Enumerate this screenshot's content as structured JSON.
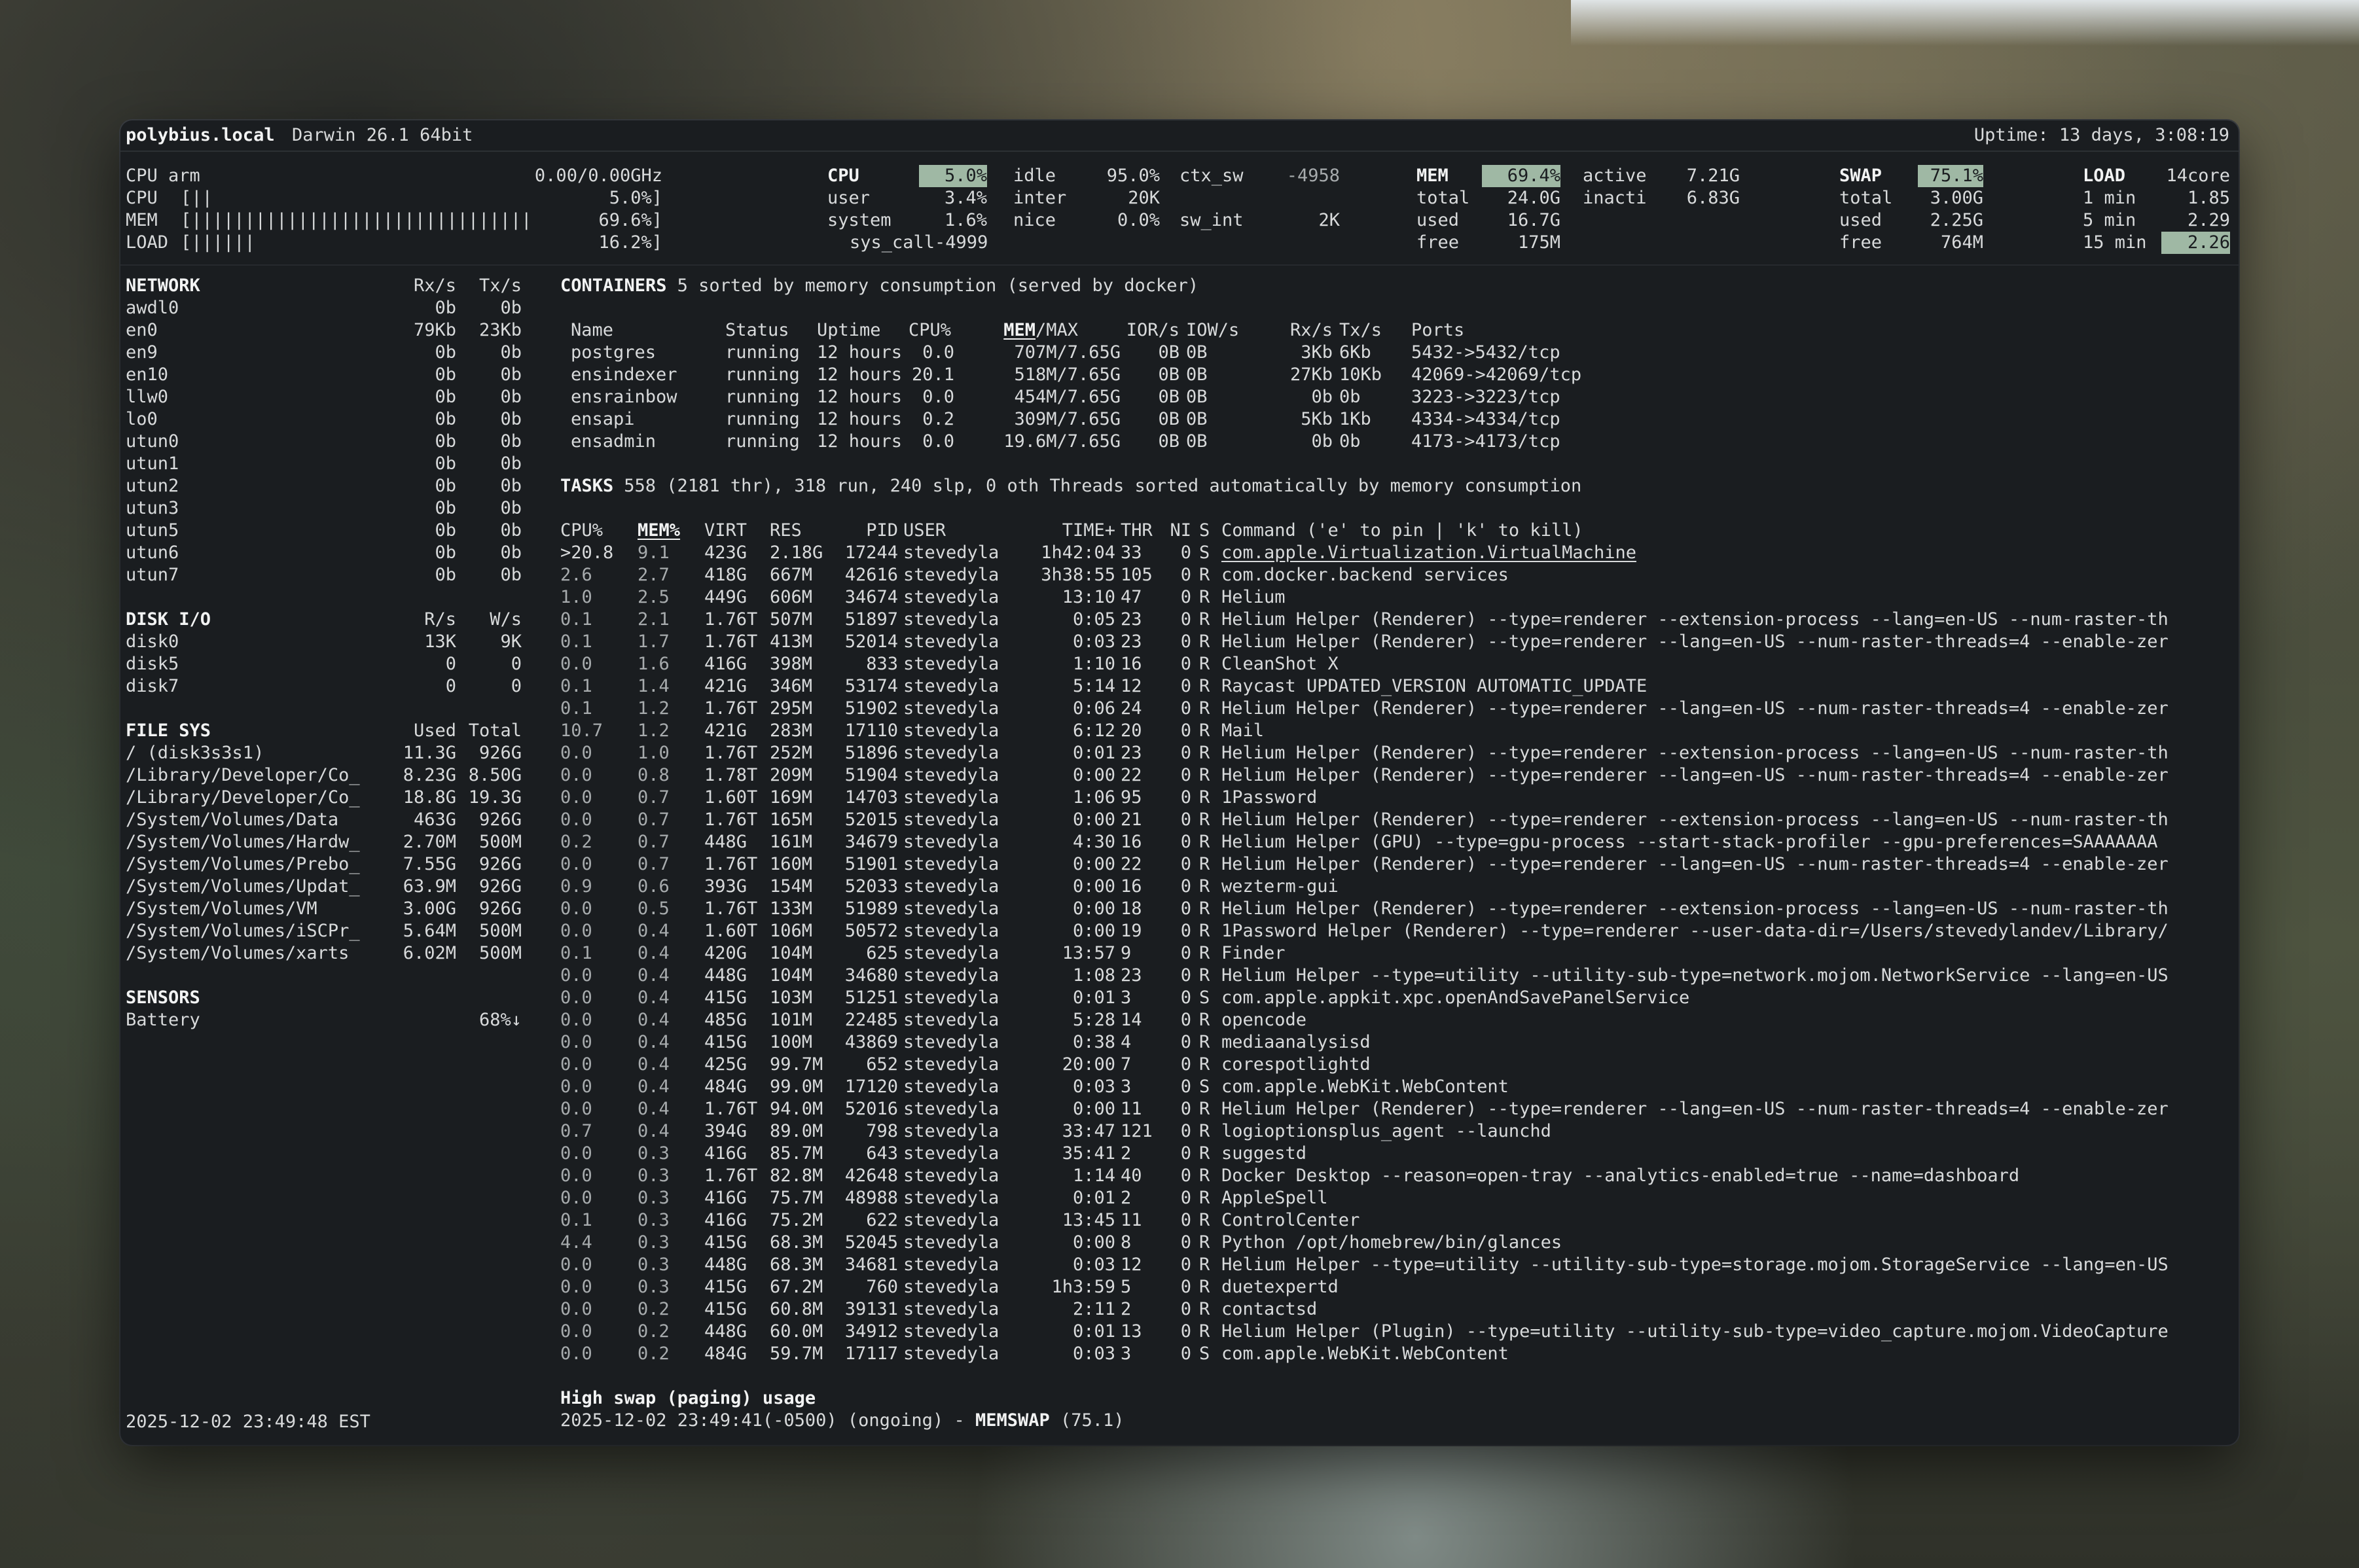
{
  "title": {
    "host": "polybius.local",
    "os": "Darwin 26.1 64bit",
    "uptime": "Uptime: 13 days, 3:08:19"
  },
  "quicklook": {
    "cpu_name": "CPU arm",
    "cpu_freq": "0.00/0.00GHz",
    "bars": [
      {
        "label": "CPU",
        "bar": "[||",
        "value": "5.0%]"
      },
      {
        "label": "MEM",
        "bar": "[||||||||||||||||||||||||||||||||",
        "value": "69.6%]"
      },
      {
        "label": "LOAD",
        "bar": "[||||||",
        "value": "16.2%]"
      }
    ]
  },
  "cpu": {
    "title": "CPU",
    "total": "5.0%",
    "rows": [
      [
        "idle",
        "95.0%",
        "ctx_sw",
        "-4958"
      ],
      [
        "user",
        "3.4%",
        "inter",
        "20K"
      ],
      [
        "system",
        "1.6%",
        "nice",
        "0.0%",
        "sw_int",
        "2K"
      ]
    ],
    "syscall": "sys_call-4999"
  },
  "mem": {
    "title": "MEM",
    "total_pct": "69.4%",
    "rows": [
      [
        "total",
        "24.0G",
        "active",
        "7.21G"
      ],
      [
        "used",
        "16.7G",
        "inacti",
        "6.83G"
      ],
      [
        "free",
        "175M"
      ]
    ]
  },
  "swap": {
    "title": "SWAP",
    "pct": "75.1%",
    "rows": [
      [
        "total",
        "3.00G"
      ],
      [
        "used",
        "2.25G"
      ],
      [
        "free",
        "764M"
      ]
    ]
  },
  "load": {
    "title": "LOAD",
    "cores": "14core",
    "rows": [
      [
        "1 min",
        "1.85"
      ],
      [
        "5 min",
        "2.29"
      ],
      [
        "15 min",
        "2.26"
      ]
    ]
  },
  "network": {
    "title": "NETWORK",
    "rx": "Rx/s",
    "tx": "Tx/s",
    "rows": [
      [
        "awdl0",
        "0b",
        "0b"
      ],
      [
        "en0",
        "79Kb",
        "23Kb"
      ],
      [
        "en9",
        "0b",
        "0b"
      ],
      [
        "en10",
        "0b",
        "0b"
      ],
      [
        "llw0",
        "0b",
        "0b"
      ],
      [
        "lo0",
        "0b",
        "0b"
      ],
      [
        "utun0",
        "0b",
        "0b"
      ],
      [
        "utun1",
        "0b",
        "0b"
      ],
      [
        "utun2",
        "0b",
        "0b"
      ],
      [
        "utun3",
        "0b",
        "0b"
      ],
      [
        "utun5",
        "0b",
        "0b"
      ],
      [
        "utun6",
        "0b",
        "0b"
      ],
      [
        "utun7",
        "0b",
        "0b"
      ]
    ]
  },
  "diskio": {
    "title": "DISK I/O",
    "r": "R/s",
    "w": "W/s",
    "rows": [
      [
        "disk0",
        "13K",
        "9K"
      ],
      [
        "disk5",
        "0",
        "0"
      ],
      [
        "disk7",
        "0",
        "0"
      ]
    ]
  },
  "fs": {
    "title": "FILE SYS",
    "used": "Used",
    "total": "Total",
    "rows": [
      [
        "/ (disk3s3s1)",
        "11.3G",
        "926G"
      ],
      [
        "/Library/Developer/Co_",
        "8.23G",
        "8.50G"
      ],
      [
        "/Library/Developer/Co_",
        "18.8G",
        "19.3G"
      ],
      [
        "/System/Volumes/Data",
        "463G",
        "926G"
      ],
      [
        "/System/Volumes/Hardw_",
        "2.70M",
        "500M"
      ],
      [
        "/System/Volumes/Prebo_",
        "7.55G",
        "926G"
      ],
      [
        "/System/Volumes/Updat_",
        "63.9M",
        "926G"
      ],
      [
        "/System/Volumes/VM",
        "3.00G",
        "926G"
      ],
      [
        "/System/Volumes/iSCPr_",
        "5.64M",
        "500M"
      ],
      [
        "/System/Volumes/xarts",
        "6.02M",
        "500M"
      ]
    ]
  },
  "sensors": {
    "title": "SENSORS",
    "rows": [
      [
        "Battery",
        "68%↓"
      ]
    ]
  },
  "datetime": "2025-12-02 23:49:48 EST",
  "containers": {
    "title": "CONTAINERS",
    "subtitle": "5 sorted by memory consumption (served by docker)",
    "headers": [
      "Name",
      "Status",
      "Uptime",
      "CPU%",
      "MEM",
      "/MAX",
      "IOR/s",
      "IOW/s",
      "Rx/s",
      "Tx/s",
      "Ports"
    ],
    "rows": [
      [
        "postgres",
        "running",
        "12 hours",
        "0.0",
        "707M/7.65G",
        "0B",
        "0B",
        "3Kb",
        "6Kb",
        "5432->5432/tcp"
      ],
      [
        "ensindexer",
        "running",
        "12 hours",
        "20.1",
        "518M/7.65G",
        "0B",
        "0B",
        "27Kb",
        "10Kb",
        "42069->42069/tcp"
      ],
      [
        "ensrainbow",
        "running",
        "12 hours",
        "0.0",
        "454M/7.65G",
        "0B",
        "0B",
        "0b",
        "0b",
        "3223->3223/tcp"
      ],
      [
        "ensapi",
        "running",
        "12 hours",
        "0.2",
        "309M/7.65G",
        "0B",
        "0B",
        "5Kb",
        "1Kb",
        "4334->4334/tcp"
      ],
      [
        "ensadmin",
        "running",
        "12 hours",
        "0.0",
        "19.6M/7.65G",
        "0B",
        "0B",
        "0b",
        "0b",
        "4173->4173/tcp"
      ]
    ]
  },
  "tasks": {
    "title": "TASKS",
    "summary": "558 (2181 thr), 318 run, 240 slp, 0 oth Threads sorted automatically by memory consumption"
  },
  "processes": {
    "headers": [
      "CPU%",
      "MEM%",
      "VIRT",
      "RES",
      "PID",
      "USER",
      "TIME+",
      "THR",
      "NI",
      "S",
      "Command ('e' to pin | 'k' to kill)"
    ],
    "rows": [
      [
        ">20.8",
        "9.1",
        "423G",
        "2.18G",
        "17244",
        "stevedyla",
        "1h42:04",
        "33",
        "0",
        "S",
        "com.apple.Virtualization.VirtualMachine"
      ],
      [
        "2.6",
        "2.7",
        "418G",
        "667M",
        "42616",
        "stevedyla",
        "3h38:55",
        "105",
        "0",
        "R",
        "com.docker.backend services"
      ],
      [
        "1.0",
        "2.5",
        "449G",
        "606M",
        "34674",
        "stevedyla",
        "13:10",
        "47",
        "0",
        "R",
        "Helium"
      ],
      [
        "0.1",
        "2.1",
        "1.76T",
        "507M",
        "51897",
        "stevedyla",
        "0:05",
        "23",
        "0",
        "R",
        "Helium Helper (Renderer) --type=renderer --extension-process --lang=en-US --num-raster-th"
      ],
      [
        "0.1",
        "1.7",
        "1.76T",
        "413M",
        "52014",
        "stevedyla",
        "0:03",
        "23",
        "0",
        "R",
        "Helium Helper (Renderer) --type=renderer --lang=en-US --num-raster-threads=4 --enable-zer"
      ],
      [
        "0.0",
        "1.6",
        "416G",
        "398M",
        "833",
        "stevedyla",
        "1:10",
        "16",
        "0",
        "R",
        "CleanShot X"
      ],
      [
        "0.1",
        "1.4",
        "421G",
        "346M",
        "53174",
        "stevedyla",
        "5:14",
        "12",
        "0",
        "R",
        "Raycast UPDATED_VERSION AUTOMATIC_UPDATE"
      ],
      [
        "0.1",
        "1.2",
        "1.76T",
        "295M",
        "51902",
        "stevedyla",
        "0:06",
        "24",
        "0",
        "R",
        "Helium Helper (Renderer) --type=renderer --lang=en-US --num-raster-threads=4 --enable-zer"
      ],
      [
        "10.7",
        "1.2",
        "421G",
        "283M",
        "17110",
        "stevedyla",
        "6:12",
        "20",
        "0",
        "R",
        "Mail"
      ],
      [
        "0.0",
        "1.0",
        "1.76T",
        "252M",
        "51896",
        "stevedyla",
        "0:01",
        "23",
        "0",
        "R",
        "Helium Helper (Renderer) --type=renderer --extension-process --lang=en-US --num-raster-th"
      ],
      [
        "0.0",
        "0.8",
        "1.78T",
        "209M",
        "51904",
        "stevedyla",
        "0:00",
        "22",
        "0",
        "R",
        "Helium Helper (Renderer) --type=renderer --lang=en-US --num-raster-threads=4 --enable-zer"
      ],
      [
        "0.0",
        "0.7",
        "1.60T",
        "169M",
        "14703",
        "stevedyla",
        "1:06",
        "95",
        "0",
        "R",
        "1Password"
      ],
      [
        "0.0",
        "0.7",
        "1.76T",
        "165M",
        "52015",
        "stevedyla",
        "0:00",
        "21",
        "0",
        "R",
        "Helium Helper (Renderer) --type=renderer --extension-process --lang=en-US --num-raster-th"
      ],
      [
        "0.2",
        "0.7",
        "448G",
        "161M",
        "34679",
        "stevedyla",
        "4:30",
        "16",
        "0",
        "R",
        "Helium Helper (GPU) --type=gpu-process --start-stack-profiler --gpu-preferences=SAAAAAAA"
      ],
      [
        "0.0",
        "0.7",
        "1.76T",
        "160M",
        "51901",
        "stevedyla",
        "0:00",
        "22",
        "0",
        "R",
        "Helium Helper (Renderer) --type=renderer --lang=en-US --num-raster-threads=4 --enable-zer"
      ],
      [
        "0.9",
        "0.6",
        "393G",
        "154M",
        "52033",
        "stevedyla",
        "0:00",
        "16",
        "0",
        "R",
        "wezterm-gui"
      ],
      [
        "0.0",
        "0.5",
        "1.76T",
        "133M",
        "51989",
        "stevedyla",
        "0:00",
        "18",
        "0",
        "R",
        "Helium Helper (Renderer) --type=renderer --extension-process --lang=en-US --num-raster-th"
      ],
      [
        "0.0",
        "0.4",
        "1.60T",
        "106M",
        "50572",
        "stevedyla",
        "0:00",
        "19",
        "0",
        "R",
        "1Password Helper (Renderer) --type=renderer --user-data-dir=/Users/stevedylandev/Library/"
      ],
      [
        "0.1",
        "0.4",
        "420G",
        "104M",
        "625",
        "stevedyla",
        "13:57",
        "9",
        "0",
        "R",
        "Finder"
      ],
      [
        "0.0",
        "0.4",
        "448G",
        "104M",
        "34680",
        "stevedyla",
        "1:08",
        "23",
        "0",
        "R",
        "Helium Helper --type=utility --utility-sub-type=network.mojom.NetworkService --lang=en-US"
      ],
      [
        "0.0",
        "0.4",
        "415G",
        "103M",
        "51251",
        "stevedyla",
        "0:01",
        "3",
        "0",
        "S",
        "com.apple.appkit.xpc.openAndSavePanelService"
      ],
      [
        "0.0",
        "0.4",
        "485G",
        "101M",
        "22485",
        "stevedyla",
        "5:28",
        "14",
        "0",
        "R",
        "opencode"
      ],
      [
        "0.0",
        "0.4",
        "415G",
        "100M",
        "43869",
        "stevedyla",
        "0:38",
        "4",
        "0",
        "R",
        "mediaanalysisd"
      ],
      [
        "0.0",
        "0.4",
        "425G",
        "99.7M",
        "652",
        "stevedyla",
        "20:00",
        "7",
        "0",
        "R",
        "corespotlightd"
      ],
      [
        "0.0",
        "0.4",
        "484G",
        "99.0M",
        "17120",
        "stevedyla",
        "0:03",
        "3",
        "0",
        "S",
        "com.apple.WebKit.WebContent"
      ],
      [
        "0.0",
        "0.4",
        "1.76T",
        "94.0M",
        "52016",
        "stevedyla",
        "0:00",
        "11",
        "0",
        "R",
        "Helium Helper (Renderer) --type=renderer --lang=en-US --num-raster-threads=4 --enable-zer"
      ],
      [
        "0.7",
        "0.4",
        "394G",
        "89.0M",
        "798",
        "stevedyla",
        "33:47",
        "121",
        "0",
        "R",
        "logioptionsplus_agent --launchd"
      ],
      [
        "0.0",
        "0.3",
        "416G",
        "85.7M",
        "643",
        "stevedyla",
        "35:41",
        "2",
        "0",
        "R",
        "suggestd"
      ],
      [
        "0.0",
        "0.3",
        "1.76T",
        "82.8M",
        "42648",
        "stevedyla",
        "1:14",
        "40",
        "0",
        "R",
        "Docker Desktop --reason=open-tray --analytics-enabled=true --name=dashboard"
      ],
      [
        "0.0",
        "0.3",
        "416G",
        "75.7M",
        "48988",
        "stevedyla",
        "0:01",
        "2",
        "0",
        "R",
        "AppleSpell"
      ],
      [
        "0.1",
        "0.3",
        "416G",
        "75.2M",
        "622",
        "stevedyla",
        "13:45",
        "11",
        "0",
        "R",
        "ControlCenter"
      ],
      [
        "4.4",
        "0.3",
        "415G",
        "68.3M",
        "52045",
        "stevedyla",
        "0:00",
        "8",
        "0",
        "R",
        "Python /opt/homebrew/bin/glances"
      ],
      [
        "0.0",
        "0.3",
        "448G",
        "68.3M",
        "34681",
        "stevedyla",
        "0:03",
        "12",
        "0",
        "R",
        "Helium Helper --type=utility --utility-sub-type=storage.mojom.StorageService --lang=en-US"
      ],
      [
        "0.0",
        "0.3",
        "415G",
        "67.2M",
        "760",
        "stevedyla",
        "1h3:59",
        "5",
        "0",
        "R",
        "duetexpertd"
      ],
      [
        "0.0",
        "0.2",
        "415G",
        "60.8M",
        "39131",
        "stevedyla",
        "2:11",
        "2",
        "0",
        "R",
        "contactsd"
      ],
      [
        "0.0",
        "0.2",
        "448G",
        "60.0M",
        "34912",
        "stevedyla",
        "0:01",
        "13",
        "0",
        "R",
        "Helium Helper (Plugin) --type=utility --utility-sub-type=video_capture.mojom.VideoCapture"
      ],
      [
        "0.0",
        "0.2",
        "484G",
        "59.7M",
        "17117",
        "stevedyla",
        "0:03",
        "3",
        "0",
        "S",
        "com.apple.WebKit.WebContent"
      ]
    ]
  },
  "alert": {
    "title": "High swap (paging) usage",
    "line": "2025-12-02 23:49:41(-0500) (ongoing) - ",
    "tag": "MEMSWAP",
    "value": " (75.1)"
  },
  "colors": {
    "window_bg": "#1a1d20",
    "text": "#d8dadb",
    "highlight": "#9fb8a4"
  }
}
